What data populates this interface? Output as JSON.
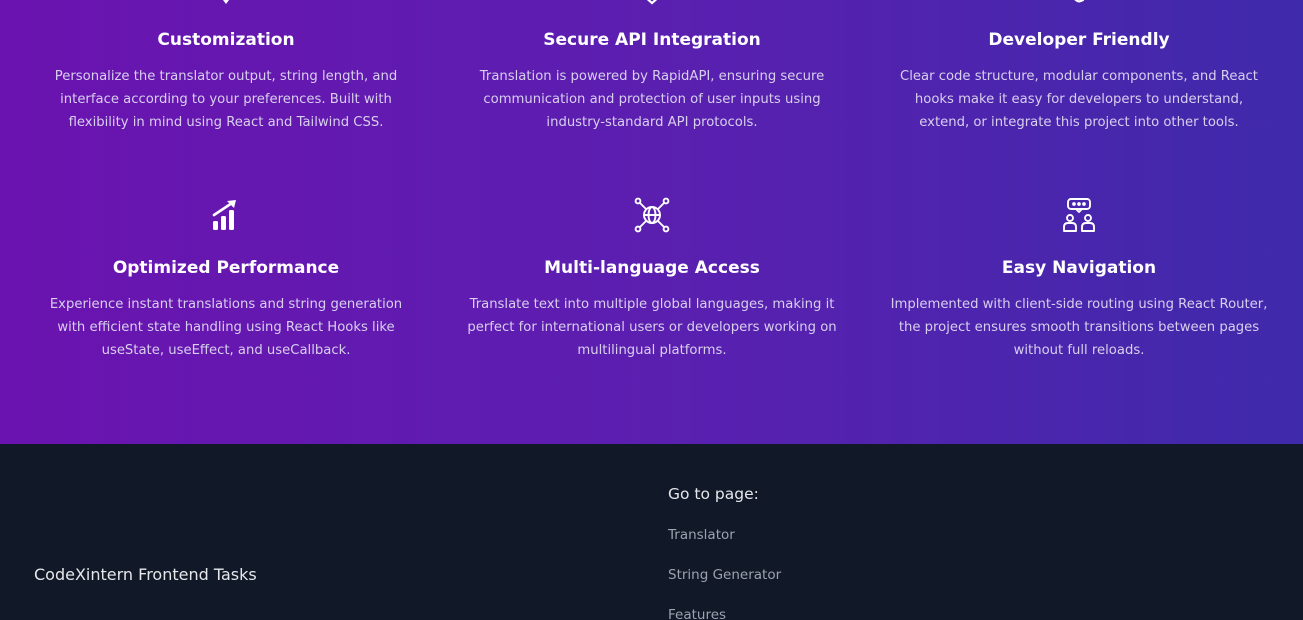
{
  "features": [
    {
      "title": "Customization",
      "description": "Personalize the translator output, string length, and interface according to your preferences. Built with flexibility in mind using React and Tailwind CSS.",
      "icon": "customize-icon"
    },
    {
      "title": "Secure API Integration",
      "description": "Translation is powered by RapidAPI, ensuring secure communication and protection of user inputs using industry-standard API protocols.",
      "icon": "shield-icon"
    },
    {
      "title": "Developer Friendly",
      "description": "Clear code structure, modular components, and React hooks make it easy for developers to understand, extend, or integrate this project into other tools.",
      "icon": "code-icon"
    },
    {
      "title": "Optimized Performance",
      "description": "Experience instant translations and string generation with efficient state handling using React Hooks like useState, useEffect, and useCallback.",
      "icon": "chart-growth-icon"
    },
    {
      "title": "Multi-language Access",
      "description": "Translate text into multiple global languages, making it perfect for international users or developers working on multilingual platforms.",
      "icon": "globe-network-icon"
    },
    {
      "title": "Easy Navigation",
      "description": "Implemented with client-side routing using React Router, the project ensures smooth transitions between pages without full reloads.",
      "icon": "users-chat-icon"
    }
  ],
  "footer": {
    "brand": "CodeXintern Frontend Tasks",
    "goto_label": "Go to page:",
    "links": [
      "Translator",
      "String Generator",
      "Features"
    ]
  },
  "colors": {
    "gradient_start": "#6b13b0",
    "gradient_end": "#3f2aab",
    "footer_bg": "#111827"
  }
}
